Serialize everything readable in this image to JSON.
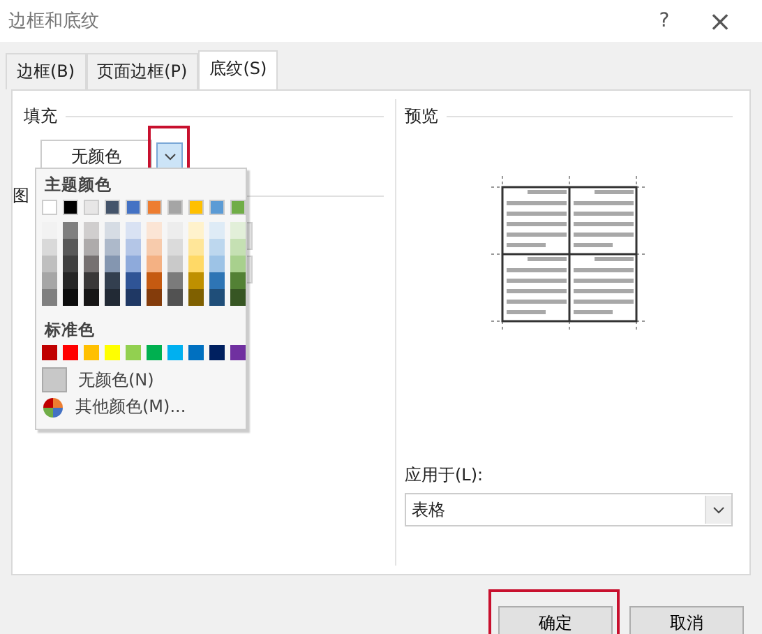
{
  "window": {
    "title": "边框和底纹",
    "help": "?",
    "close": "×"
  },
  "tabs": [
    {
      "label": "边框(B)",
      "selected": false
    },
    {
      "label": "页面边框(P)",
      "selected": false
    },
    {
      "label": "底纹(S)",
      "selected": true
    }
  ],
  "fill": {
    "label": "填充",
    "value": "无颜色",
    "highlighted": true
  },
  "pattern": {
    "label": "图"
  },
  "palette": {
    "theme_title": "主题颜色",
    "theme": [
      {
        "color": "#ffffff",
        "shades": [
          {
            "color": "#f2f2f2"
          },
          {
            "color": "#d9d9d9"
          },
          {
            "color": "#bfbfbf"
          },
          {
            "color": "#a6a6a6"
          },
          {
            "color": "#808080"
          }
        ]
      },
      {
        "color": "#000000",
        "shades": [
          {
            "color": "#7f7f7f"
          },
          {
            "color": "#595959"
          },
          {
            "color": "#404040"
          },
          {
            "color": "#262626"
          },
          {
            "color": "#0d0d0d"
          }
        ]
      },
      {
        "color": "#e7e6e6",
        "shades": [
          {
            "color": "#d0cece"
          },
          {
            "color": "#aeabab"
          },
          {
            "color": "#767171"
          },
          {
            "color": "#3a3838"
          },
          {
            "color": "#171616"
          }
        ]
      },
      {
        "color": "#44546a",
        "shades": [
          {
            "color": "#d6dce4"
          },
          {
            "color": "#adb9ca"
          },
          {
            "color": "#8496b0"
          },
          {
            "color": "#333f4f"
          },
          {
            "color": "#222a35"
          }
        ]
      },
      {
        "color": "#4472c4",
        "shades": [
          {
            "color": "#d9e2f3"
          },
          {
            "color": "#b4c6e7"
          },
          {
            "color": "#8eaadb"
          },
          {
            "color": "#2f5496"
          },
          {
            "color": "#1f3864"
          }
        ]
      },
      {
        "color": "#ed7d31",
        "shades": [
          {
            "color": "#fbe5d5"
          },
          {
            "color": "#f7cbac"
          },
          {
            "color": "#f4b183"
          },
          {
            "color": "#c55a11"
          },
          {
            "color": "#843c0b"
          }
        ]
      },
      {
        "color": "#a5a5a5",
        "shades": [
          {
            "color": "#ededed"
          },
          {
            "color": "#dbdbdb"
          },
          {
            "color": "#c9c9c9"
          },
          {
            "color": "#7b7b7b"
          },
          {
            "color": "#525252"
          }
        ]
      },
      {
        "color": "#ffc000",
        "shades": [
          {
            "color": "#fff2cc"
          },
          {
            "color": "#ffe699"
          },
          {
            "color": "#ffd966"
          },
          {
            "color": "#bf9000"
          },
          {
            "color": "#7f6000"
          }
        ]
      },
      {
        "color": "#5b9bd5",
        "shades": [
          {
            "color": "#deebf6"
          },
          {
            "color": "#bdd7ee"
          },
          {
            "color": "#9dc3e6"
          },
          {
            "color": "#2e75b5"
          },
          {
            "color": "#1f4e79"
          }
        ]
      },
      {
        "color": "#70ad47",
        "shades": [
          {
            "color": "#e2efd9"
          },
          {
            "color": "#c5e0b3"
          },
          {
            "color": "#a8d08d"
          },
          {
            "color": "#538135"
          },
          {
            "color": "#375623"
          }
        ]
      }
    ],
    "standard_title": "标准色",
    "standard": [
      {
        "color": "#c00000"
      },
      {
        "color": "#ff0000"
      },
      {
        "color": "#ffc000"
      },
      {
        "color": "#ffff00"
      },
      {
        "color": "#92d050"
      },
      {
        "color": "#00b050"
      },
      {
        "color": "#00b0f0"
      },
      {
        "color": "#0070c0"
      },
      {
        "color": "#002060"
      },
      {
        "color": "#7030a0"
      }
    ],
    "no_color": "无颜色(N)",
    "more_colors": "其他颜色(M)..."
  },
  "preview": {
    "label": "预览"
  },
  "apply_to": {
    "label": "应用于(L):",
    "value": "表格"
  },
  "buttons": [
    {
      "label": "确定",
      "highlighted": true
    },
    {
      "label": "取消",
      "highlighted": false
    }
  ]
}
